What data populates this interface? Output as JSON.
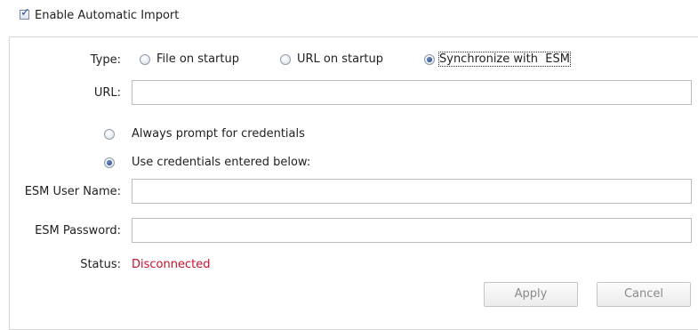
{
  "auto_import": {
    "label": "Enable Automatic Import",
    "checked": true
  },
  "type": {
    "label": "Type:",
    "options": [
      {
        "label": "File on startup",
        "selected": false
      },
      {
        "label": "URL on startup",
        "selected": false
      },
      {
        "label": "Synchronize with  ESM",
        "selected": true
      }
    ]
  },
  "url": {
    "label": "URL:",
    "value": ""
  },
  "credentials": {
    "options": [
      {
        "label": "Always prompt for credentials",
        "selected": false
      },
      {
        "label": "Use credentials entered below:",
        "selected": true
      }
    ]
  },
  "esm_user": {
    "label": "ESM User Name:",
    "value": ""
  },
  "esm_password": {
    "label": "ESM Password:",
    "value": ""
  },
  "status": {
    "label": "Status:",
    "value": "Disconnected",
    "color": "#c8102e"
  },
  "buttons": {
    "apply": "Apply",
    "cancel": "Cancel"
  }
}
